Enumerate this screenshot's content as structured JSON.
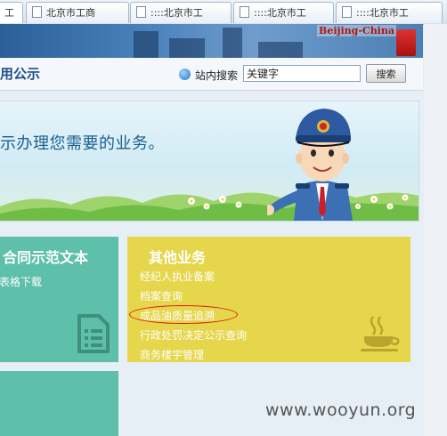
{
  "browser": {
    "tabs": [
      {
        "label": "工",
        "active": true
      },
      {
        "label": "北京市工商",
        "active": false
      },
      {
        "label": "::::北京市工",
        "active": false
      },
      {
        "label": "::::北京市工",
        "active": false
      },
      {
        "label": "::::北京市工",
        "active": false
      }
    ]
  },
  "header": {
    "brand": "Beijing-China"
  },
  "subnav": {
    "title": "用公示",
    "search_label": "站内搜索",
    "search_value": "关键字",
    "search_button": "搜索"
  },
  "hero": {
    "welcome_text": "示办理您需要的业务。"
  },
  "tiles": {
    "contract": {
      "title": "合同示范文本",
      "link": "表格下载"
    },
    "other": {
      "title": "其他业务",
      "links": [
        "经纪人执业备案",
        "档案查询",
        "成品油质量追溯",
        "行政处罚决定公示查询",
        "商务楼宇管理"
      ]
    }
  },
  "watermark": "www.wooyun.org",
  "colors": {
    "teal_tile": "#5ebfaa",
    "yellow_tile": "#e5d64b",
    "annotation": "#dd1111"
  }
}
